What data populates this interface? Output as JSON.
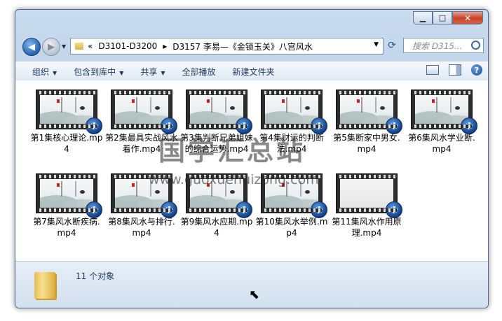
{
  "window": {
    "caption": {
      "minimize": "▁",
      "maximize": "□",
      "close": "✕"
    }
  },
  "nav": {
    "back": "◀",
    "forward": "▶",
    "breadcrumb": [
      "«",
      "D3101-D3200",
      "▸",
      "D3157 李易—《金锁玉关》八宫风水"
    ],
    "search_placeholder": "搜索 D315..."
  },
  "toolbar": {
    "organize": "组织",
    "include_library": "包含到库中",
    "share": "共享",
    "play_all": "全部播放",
    "new_folder": "新建文件夹"
  },
  "files": [
    {
      "name": "第1集核心理论.mp4"
    },
    {
      "name": "第2集最具实战风水着作.mp4"
    },
    {
      "name": "第3集判断兄弟姐妹的综合运势.mp4"
    },
    {
      "name": "第4集财运的判断法.mp4"
    },
    {
      "name": "第5集断家中男女.mp4"
    },
    {
      "name": "第6集风水学业断.mp4"
    },
    {
      "name": "第7集风水断疾病.mp4"
    },
    {
      "name": "第8集风水与排行.mp4"
    },
    {
      "name": "第9集风水应期.mp4"
    },
    {
      "name": "第10集风水举例.mp4"
    },
    {
      "name": "第11集风水作用原理.mp4"
    }
  ],
  "status": {
    "count": "11 个对象"
  },
  "watermark": {
    "text": "国学汇总站",
    "url": "www.guoxuehuizong.com"
  },
  "colors": {
    "accent": "#2563b2",
    "window_frame": "#b4c9e2"
  }
}
